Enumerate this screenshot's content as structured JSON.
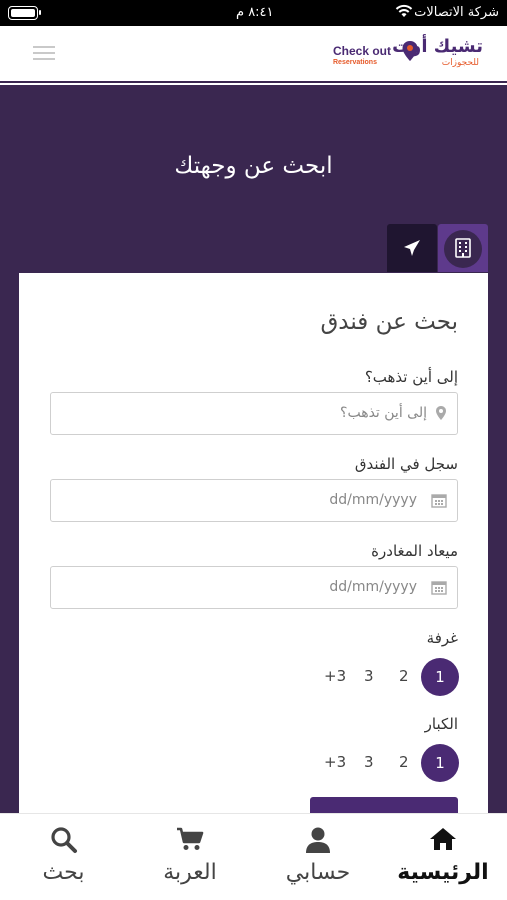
{
  "status_bar": {
    "carrier": "شركة الاتصالات",
    "time": "٨:٤١ م"
  },
  "header": {
    "logo_ar": "تشيك أوت",
    "logo_ar_sub": "للحجوزات",
    "logo_en": "Check out",
    "logo_en_sub": "Reservations"
  },
  "hero": {
    "title": "ابحث عن وجهتك"
  },
  "tabs": [
    {
      "name": "hotel",
      "icon": "building-icon",
      "active": true
    },
    {
      "name": "flight",
      "icon": "airplane-icon",
      "active": false
    }
  ],
  "form": {
    "title": "بحث عن فندق",
    "destination": {
      "label": "إلى أين تذهب؟",
      "placeholder": "إلى أين تذهب؟"
    },
    "checkin": {
      "label": "سجل في الفندق",
      "placeholder": "dd/mm/yyyy"
    },
    "checkout": {
      "label": "ميعاد المغادرة",
      "placeholder": "dd/mm/yyyy"
    },
    "rooms": {
      "label": "غرفة",
      "options": [
        "1",
        "2",
        "3",
        "+3"
      ],
      "selected": "1"
    },
    "adults": {
      "label": "الكبار",
      "options": [
        "1",
        "2",
        "3",
        "+3"
      ],
      "selected": "1"
    }
  },
  "bottom_nav": {
    "home": "الرئيسية",
    "account": "حسابي",
    "cart": "العربة",
    "search": "بحث"
  },
  "colors": {
    "primary": "#4a2a73",
    "hero_bg": "#3a2750",
    "accent": "#e65a2a"
  }
}
